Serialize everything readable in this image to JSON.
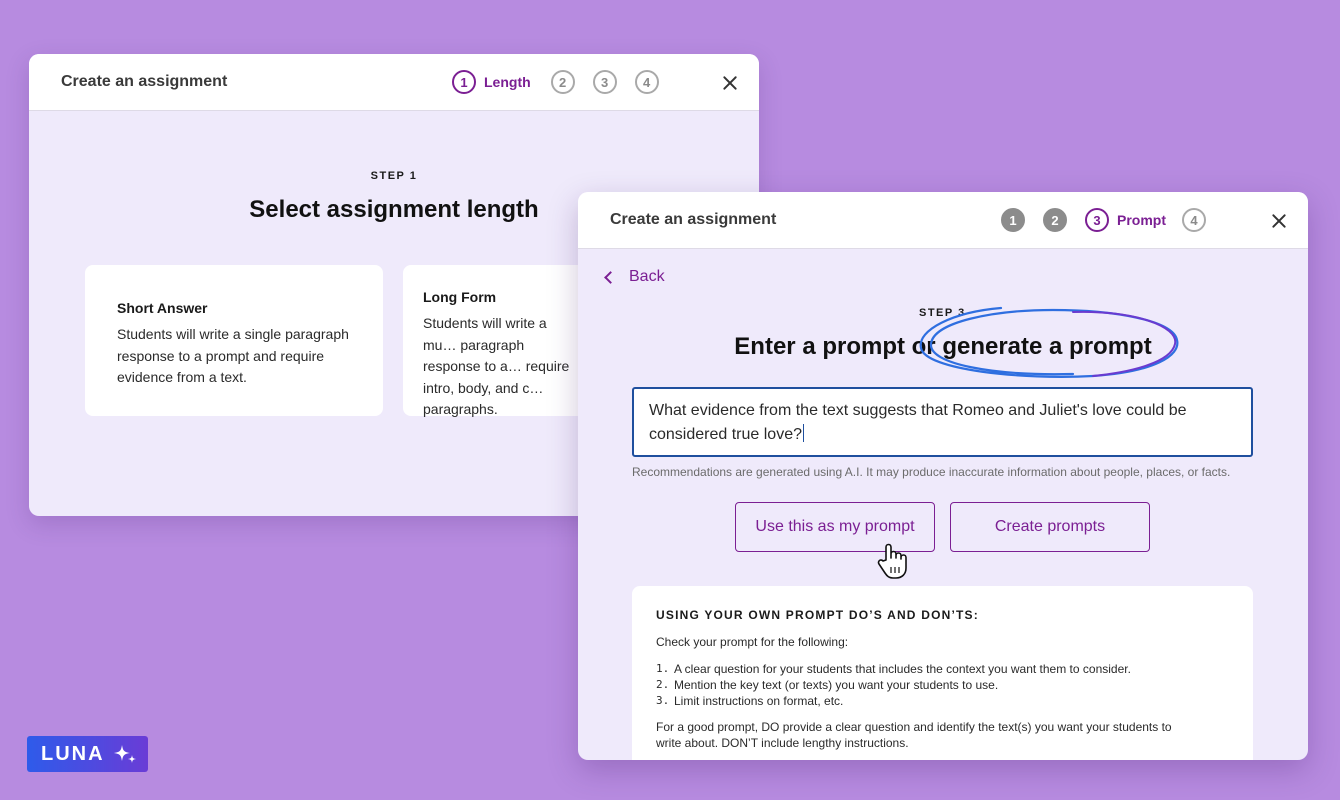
{
  "dialog_back": {
    "title": "Create an assignment",
    "steps": [
      "1",
      "2",
      "3",
      "4"
    ],
    "active_step_label": "Length",
    "step_kicker": "STEP 1",
    "heading": "Select assignment length",
    "cards": [
      {
        "title": "Short Answer",
        "desc": "Students will write a single paragraph response to a prompt and require evidence from a text."
      },
      {
        "title": "Long Form",
        "desc": "Students will write a mu… paragraph response to a… require intro, body, and c… paragraphs."
      }
    ]
  },
  "dialog_front": {
    "title": "Create an assignment",
    "steps": [
      "1",
      "2",
      "3",
      "4"
    ],
    "active_step_label": "Prompt",
    "back_label": "Back",
    "step_kicker": "STEP 3",
    "heading": "Enter a prompt or generate a prompt",
    "prompt_value": "What evidence from the text suggests that Romeo and Juliet's love could be considered true love?",
    "ai_note": "Recommendations are generated using A.I. It may produce inaccurate information about people, places, or facts.",
    "use_prompt_label": "Use this as my prompt",
    "create_prompts_label": "Create prompts",
    "tips": {
      "title": "USING YOUR OWN PROMPT DO’S AND DON’TS:",
      "subtitle": "Check your prompt for the following:",
      "items": [
        {
          "num": "1.",
          "text": "A clear question for your students that includes the context you want them to consider."
        },
        {
          "num": "2.",
          "text": "Mention the key text (or texts) you want your students to use."
        },
        {
          "num": "3.",
          "text": "Limit instructions on format, etc."
        }
      ],
      "footer": "For a good prompt, DO provide a clear question and identify the text(s) you want your students to write about. DON’T include lengthy instructions."
    }
  },
  "badge": {
    "label": "LUNA",
    "icon": "sparkle-icon"
  },
  "colors": {
    "background": "#b78be0",
    "accent": "#7b1f93",
    "dialog_body": "#efeafb",
    "input_border": "#1f4f9e"
  }
}
